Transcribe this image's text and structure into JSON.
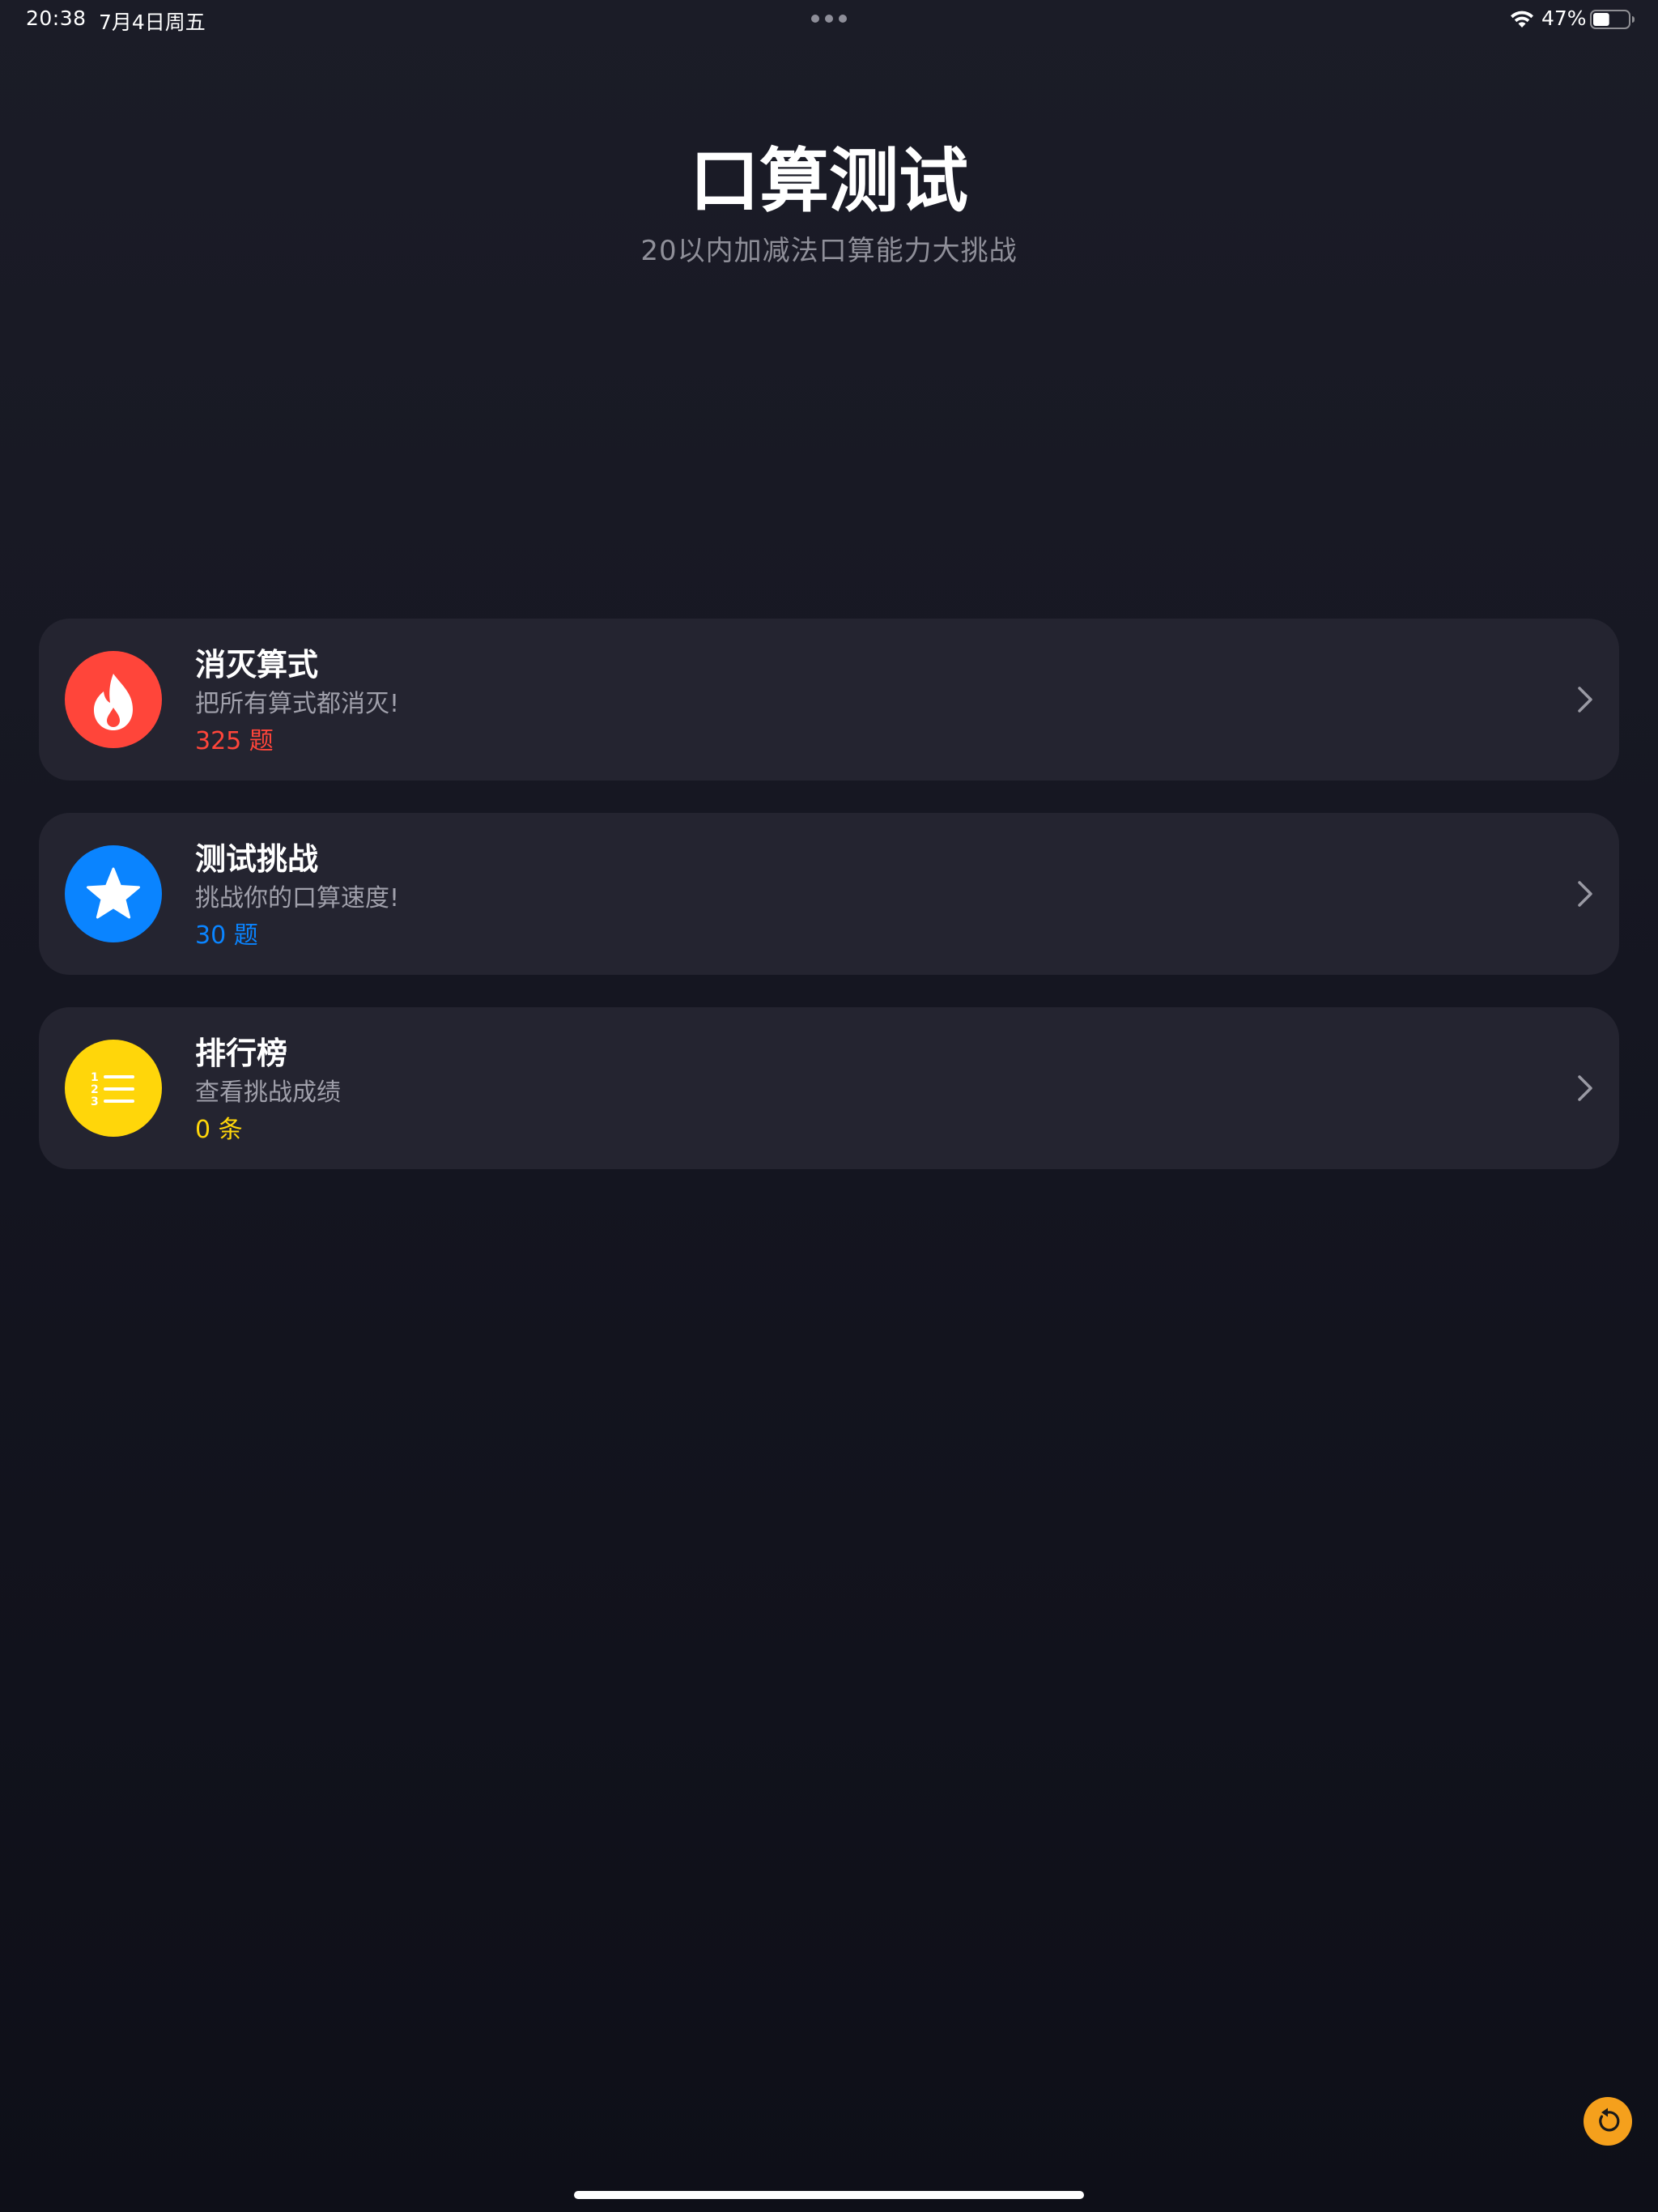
{
  "status_bar": {
    "time": "20:38",
    "date": "7月4日周五",
    "battery": "47%",
    "battery_level": 0.47
  },
  "header": {
    "title": "口算测试",
    "subtitle": "20以内加减法口算能力大挑战"
  },
  "cards": [
    {
      "title": "消灭算式",
      "description": "把所有算式都消灭!",
      "count": "325 题",
      "icon": "flame-icon",
      "color": "#ff453a"
    },
    {
      "title": "测试挑战",
      "description": "挑战你的口算速度!",
      "count": "30 题",
      "icon": "star-icon",
      "color": "#0a84ff"
    },
    {
      "title": "排行榜",
      "description": "查看挑战成绩",
      "count": "0 条",
      "icon": "numbered-list-icon",
      "color": "#ffd60a"
    }
  ],
  "refresh_button": {
    "icon": "refresh-icon",
    "color": "#f5a01c"
  }
}
